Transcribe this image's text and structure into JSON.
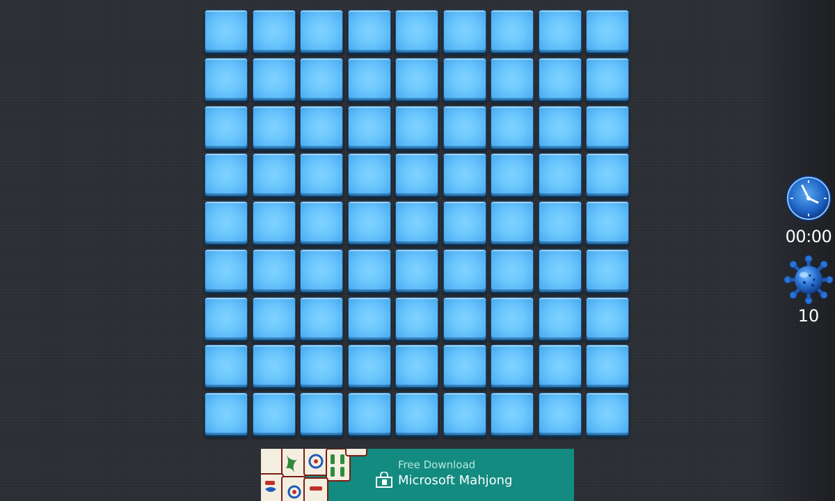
{
  "board": {
    "rows": 9,
    "columns": 9,
    "tile_color": "#6cc6fd",
    "tile_state": "covered"
  },
  "hud": {
    "clock_icon": "clock-icon",
    "timer": "00:00",
    "mine_icon": "mine-icon",
    "mines_remaining": "10"
  },
  "ad": {
    "subtitle": "Free Download",
    "title": "Microsoft Mahjong",
    "background_color": "#138b80",
    "art_icon": "mahjong-tiles-art",
    "logo_icon": "store-bag-icon"
  }
}
